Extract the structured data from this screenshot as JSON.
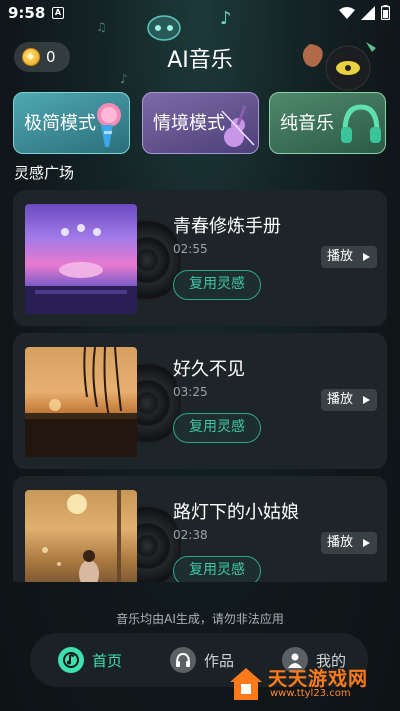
{
  "status_bar": {
    "time": "9:58",
    "notification_letter": "A"
  },
  "header": {
    "coins": "0",
    "title": "AI音乐"
  },
  "modes": [
    {
      "label": "极简模式",
      "icon": "microphone-icon"
    },
    {
      "label": "情境模式",
      "icon": "violin-icon"
    },
    {
      "label": "纯音乐",
      "icon": "headphones-icon"
    }
  ],
  "section_title": "灵感广场",
  "songs": [
    {
      "title": "青春修炼手册",
      "duration": "02:55",
      "reuse_label": "复用灵感",
      "play_label": "播放"
    },
    {
      "title": "好久不见",
      "duration": "03:25",
      "reuse_label": "复用灵感",
      "play_label": "播放"
    },
    {
      "title": "路灯下的小姑娘",
      "duration": "02:38",
      "reuse_label": "复用灵感",
      "play_label": "播放"
    }
  ],
  "disclaimer": "音乐均由AI生成，请勿非法应用",
  "nav": [
    {
      "label": "首页",
      "icon": "music-note-icon",
      "active": true
    },
    {
      "label": "作品",
      "icon": "headphones-icon",
      "active": false
    },
    {
      "label": "我的",
      "icon": "person-icon",
      "active": false
    }
  ],
  "watermark": {
    "name": "天天游戏网",
    "url": "www.ttyl23.com"
  },
  "colors": {
    "accent": "#3fe0b0",
    "background": "#121a1f",
    "card": "#1e2529"
  }
}
